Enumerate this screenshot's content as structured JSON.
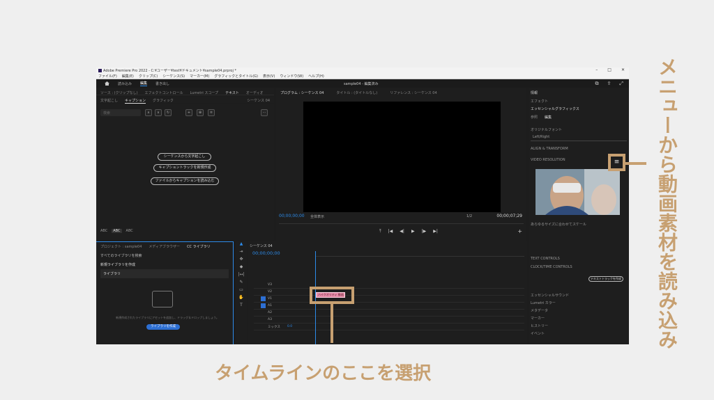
{
  "window": {
    "title": "Adobe Premiere Pro 2022 - C:¥ユーザー¥test¥ドキュメント¥sample04.prproj *",
    "menu": [
      "ファイル(F)",
      "編集(E)",
      "クリップ(C)",
      "シーケンス(S)",
      "マーカー(M)",
      "グラフィックとタイトル(G)",
      "表示(V)",
      "ウィンドウ(W)",
      "ヘルプ(H)"
    ],
    "workspace_tabs": [
      "読み込み",
      "編集",
      "書き出し"
    ],
    "project_name": "sample04 - 編集済み"
  },
  "text_panel": {
    "top_tabs": [
      "ソース : (クリップなし)",
      "エフェクトコントロール",
      "Lumetri スコープ",
      "テキスト",
      "オーディオ"
    ],
    "sub_tabs": [
      "文字起こし",
      "キャプション",
      "グラフィック"
    ],
    "sequence_label": "シーケンス 04",
    "search_placeholder": "検索",
    "buttons": [
      "シーケンスから文字起こし",
      "キャプショントラックを新規作成",
      "ファイルからキャプションを読み込む"
    ],
    "abc": [
      "ABC",
      "ABC",
      "ABC"
    ]
  },
  "program": {
    "tabs": [
      "プログラム : シーケンス 04",
      "タイトル : (タイトルなし)",
      "リファレンス : シーケンス 04"
    ],
    "tc_in": "00;00;00;00",
    "tc_out": "00;00;07;29",
    "fit": "全体表示",
    "ratio": "1/2"
  },
  "essential": {
    "header": "情報",
    "effects": "エフェクト",
    "title": "エッセンシャルグラフィックス",
    "tabs": [
      "参照",
      "編集"
    ],
    "font_section": "オリジナルフォント",
    "font_value": "Left/Right",
    "items": [
      "ALIGN & TRANSFORM",
      "VIDEO RESOLUTION",
      "TEXT CONTROLS",
      "CLOCK/TIME CONTROLS"
    ],
    "resize": "あらゆるサイズに合わせてスケール",
    "button": "テキストトラックを作成",
    "footer": [
      "エッセンシャルサウンド",
      "Lumetri カラー",
      "メタデータ",
      "マーカー",
      "ヒストリー",
      "イベント"
    ]
  },
  "library": {
    "tabs": [
      "プロジェクト : sample04",
      "メディアブラウザー",
      "CC ライブラリ"
    ],
    "search": "すべてのライブラリを検索",
    "new": "新規ライブラリを作成",
    "section": "ライブラリ",
    "desc": "新規作成されたライブラリにアセットを追加し、ドラッグ＆ドロップしましょう。",
    "create_button": "ライブラリを作成"
  },
  "timeline": {
    "tab": "シーケンス 04",
    "tc": "00;00;00;00",
    "tracks": [
      "V3",
      "V2",
      "V1",
      "A1",
      "A2",
      "A3"
    ],
    "mix": "ミックス",
    "mix_value": "0.0",
    "clip": "ハイクオリティ 動画"
  },
  "annotations": {
    "timeline_label": "タイムラインのここを選択",
    "menu_label": "メニューから動画素材を読み込み",
    "menu_icon": "≡"
  }
}
